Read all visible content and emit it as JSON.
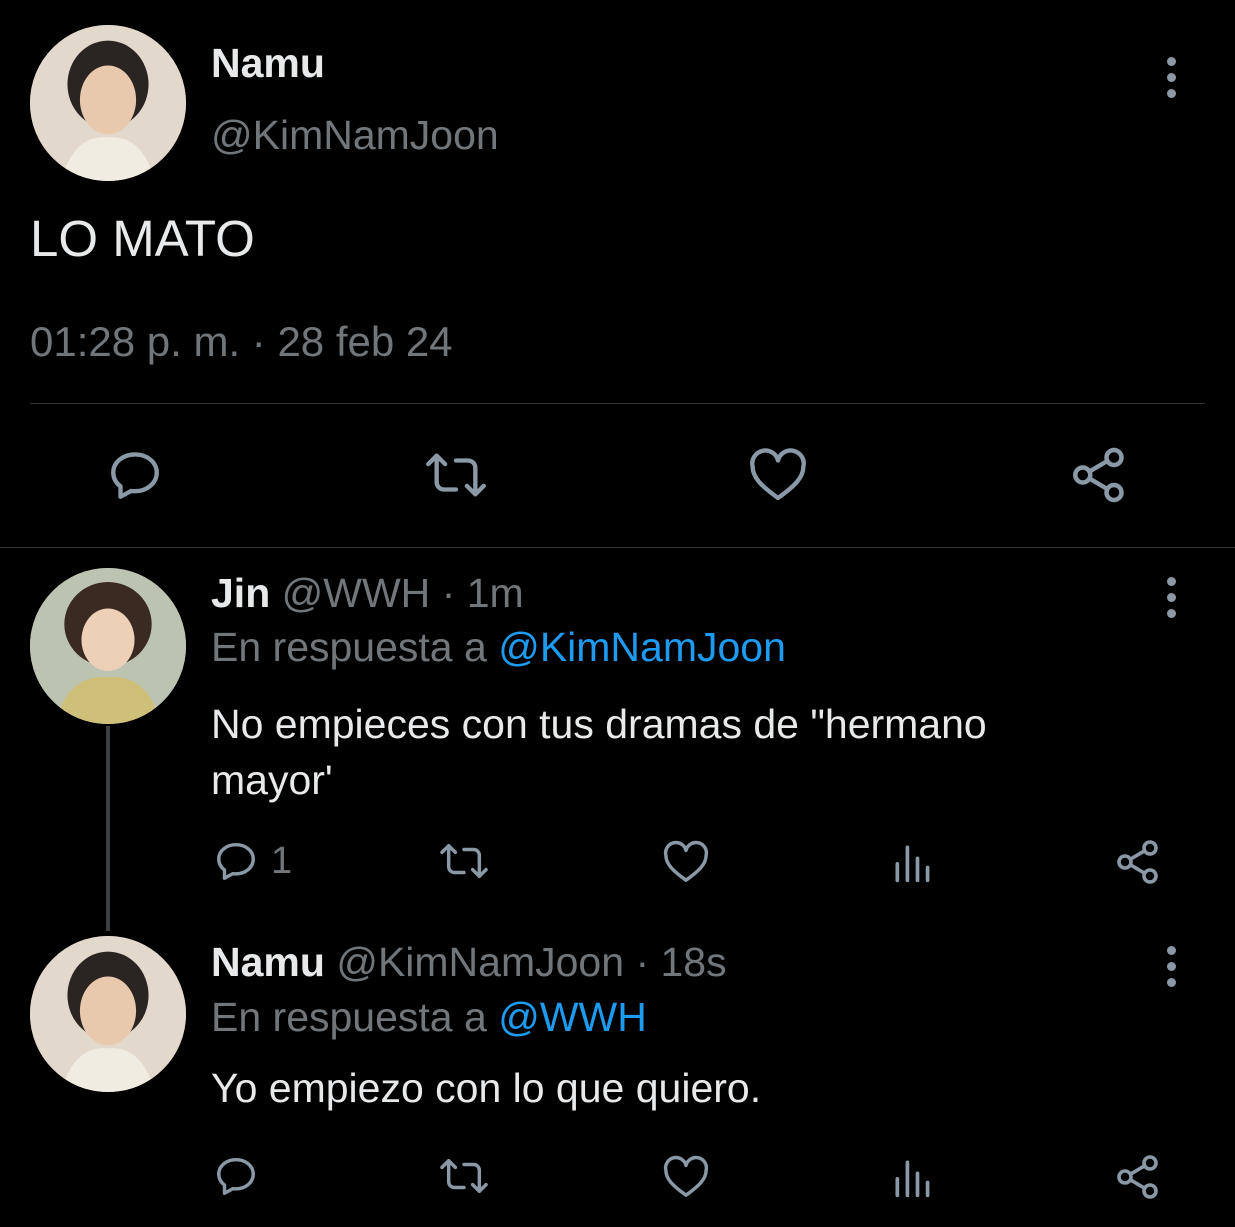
{
  "main_tweet": {
    "display_name": "Namu",
    "handle": "@KimNamJoon",
    "text": "LO MATO",
    "timestamp": "01:28 p. m. · 28 feb 24",
    "actions": [
      "reply-icon",
      "retweet-icon",
      "like-icon",
      "share-icon"
    ]
  },
  "replies": [
    {
      "display_name": "Jin",
      "handle": "@WWH",
      "time": "· 1m",
      "replying_prefix": "En respuesta a",
      "replying_to": "@KimNamJoon",
      "text_line1": "No empieces con tus dramas de \"hermano",
      "text_line2": "mayor'",
      "reply_count": "1"
    },
    {
      "display_name": "Namu",
      "handle": "@KimNamJoon",
      "time": "· 18s",
      "replying_prefix": "En respuesta a",
      "replying_to": "@WWH",
      "text_line1": "Yo empiezo con lo que quiero.",
      "reply_count": ""
    }
  ],
  "colors": {
    "background": "#000000",
    "text": "#e7e9ea",
    "muted": "#71767b",
    "accent": "#1d9bf0",
    "icon": "#8b98a5"
  }
}
